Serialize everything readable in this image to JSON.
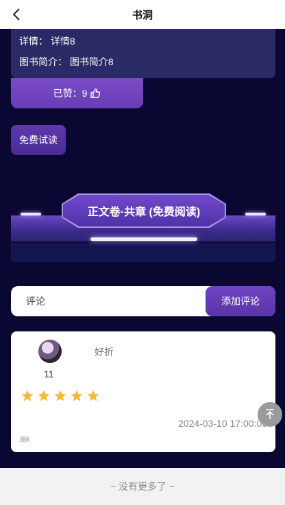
{
  "header": {
    "title": "书洞",
    "back_icon": "chevron-left-icon"
  },
  "details": {
    "detail_label": "详情：",
    "detail_value": "详情8",
    "intro_label": "图书简介：",
    "intro_value": "图书简介8"
  },
  "likes": {
    "label": "已赞：9",
    "icon": "thumbs-up-icon"
  },
  "free_read_button": "免费试读",
  "volume_banner": {
    "label": "正文卷·共章 (免费阅读)"
  },
  "comment_input": {
    "placeholder": "评论",
    "value": ""
  },
  "add_comment_button": "添加评论",
  "comments": [
    {
      "user_name": "好折",
      "like_count": "11",
      "rating": 5,
      "time": "2024-03-10 17:00:06",
      "tag": "图8"
    }
  ],
  "footer": {
    "text": "~ 没有更多了 ~"
  },
  "colors": {
    "page_bg": "#0a0833",
    "accent_purple": "#6e44c2",
    "star": "#f5b935"
  }
}
